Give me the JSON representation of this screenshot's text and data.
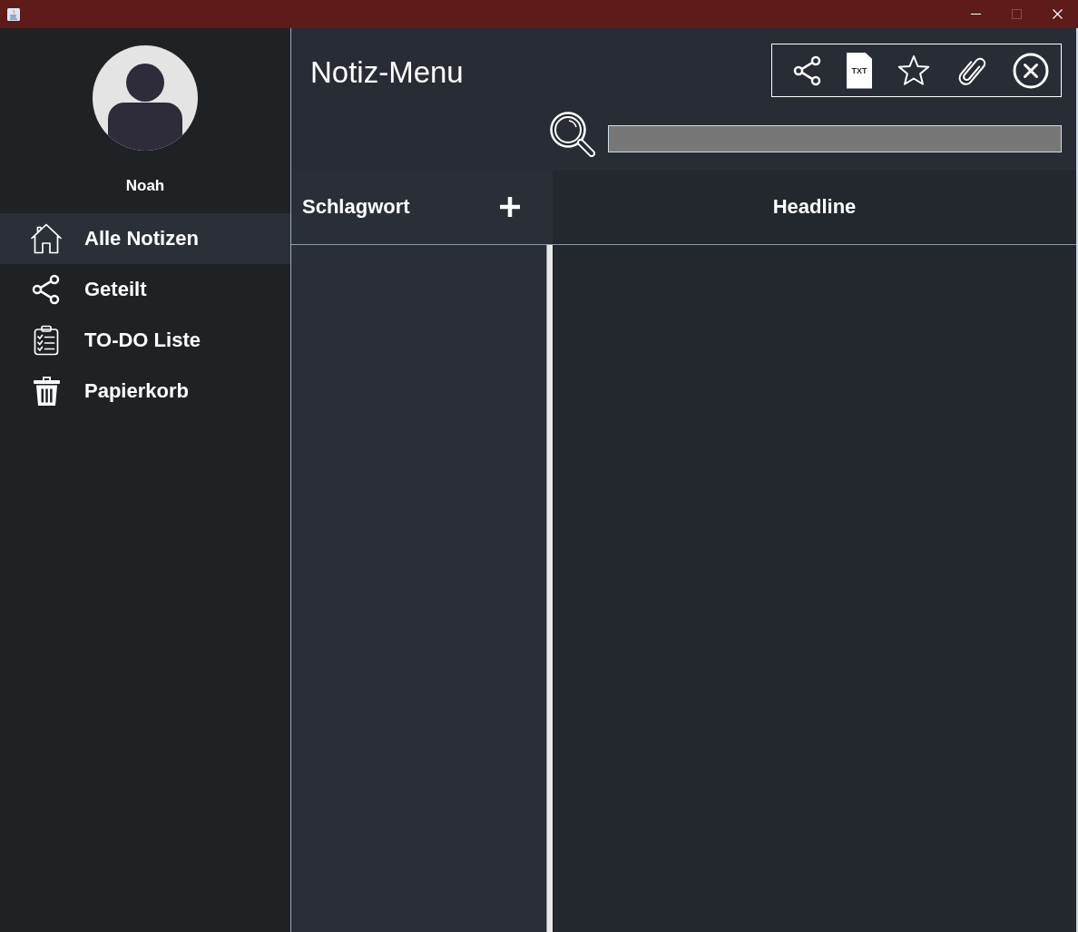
{
  "window": {
    "controls": [
      {
        "kind": "minimize",
        "disabled": false
      },
      {
        "kind": "maximize",
        "disabled": true
      },
      {
        "kind": "close",
        "disabled": false
      }
    ]
  },
  "sidebar": {
    "user": {
      "name": "Noah"
    },
    "items": [
      {
        "kind": "home",
        "label": "Alle Notizen",
        "selected": true
      },
      {
        "kind": "share",
        "label": "Geteilt",
        "selected": false
      },
      {
        "kind": "checklist",
        "label": "TO-DO Liste",
        "selected": false
      },
      {
        "kind": "trash",
        "label": "Papierkorb",
        "selected": false
      }
    ]
  },
  "header": {
    "title": "Notiz-Menu",
    "tools": [
      {
        "kind": "share"
      },
      {
        "kind": "txt",
        "label": "TXT"
      },
      {
        "kind": "star"
      },
      {
        "kind": "attach"
      },
      {
        "kind": "close"
      }
    ]
  },
  "tags_panel": {
    "heading": "Schlagwort"
  },
  "notes_panel": {
    "heading": "Headline"
  }
}
